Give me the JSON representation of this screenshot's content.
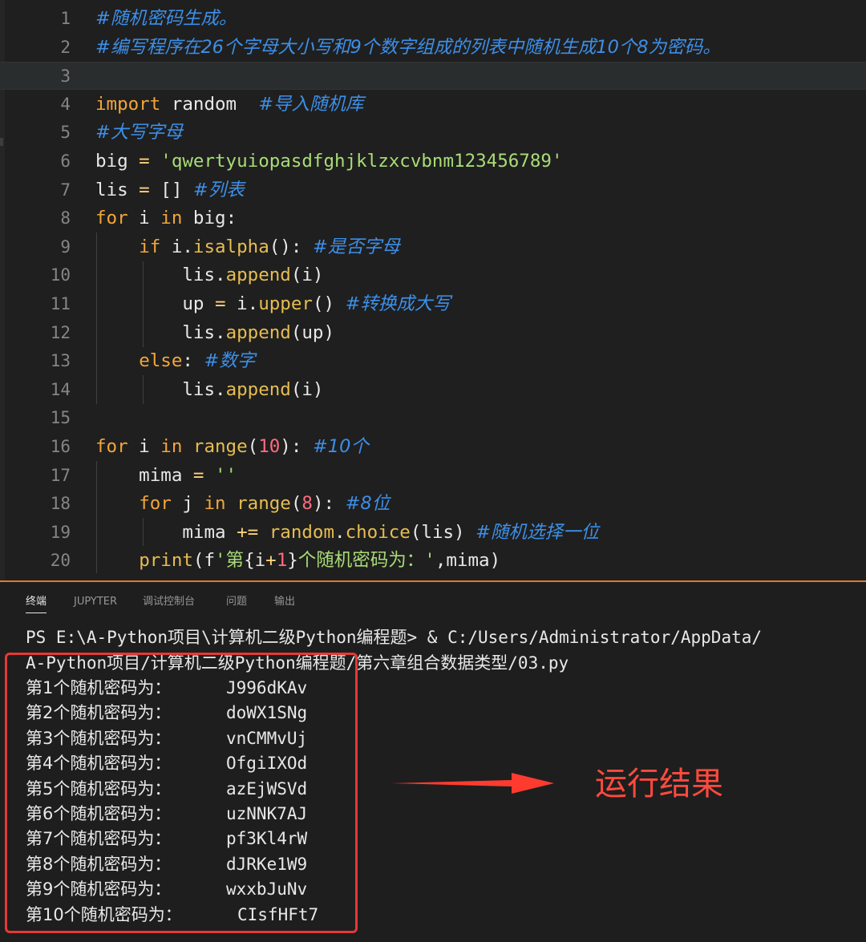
{
  "editor": {
    "lines": [
      {
        "n": "1",
        "tokens": [
          {
            "c": "cmt",
            "t": "#随机密码生成。"
          }
        ]
      },
      {
        "n": "2",
        "tokens": [
          {
            "c": "cmt",
            "t": "#编写程序在26个字母大小写和9个数字组成的列表中随机生成10个8为密码。"
          }
        ]
      },
      {
        "n": "3",
        "tokens": []
      },
      {
        "n": "4",
        "tokens": [
          {
            "c": "kw",
            "t": "import"
          },
          {
            "c": "var",
            "t": " random  "
          },
          {
            "c": "cmt",
            "t": "#导入随机库"
          }
        ]
      },
      {
        "n": "5",
        "tokens": [
          {
            "c": "cmt",
            "t": "#大写字母"
          }
        ]
      },
      {
        "n": "6",
        "tokens": [
          {
            "c": "var",
            "t": "big"
          },
          {
            "c": "op",
            "t": " = "
          },
          {
            "c": "str",
            "t": "'qwertyuiopasdfghjklzxcvbnm123456789'"
          }
        ]
      },
      {
        "n": "7",
        "tokens": [
          {
            "c": "var",
            "t": "lis"
          },
          {
            "c": "op",
            "t": " = "
          },
          {
            "c": "pun",
            "t": "[] "
          },
          {
            "c": "cmt",
            "t": "#列表"
          }
        ]
      },
      {
        "n": "8",
        "tokens": [
          {
            "c": "kw",
            "t": "for"
          },
          {
            "c": "var",
            "t": " i "
          },
          {
            "c": "kw",
            "t": "in"
          },
          {
            "c": "var",
            "t": " big"
          },
          {
            "c": "pun",
            "t": ":"
          }
        ]
      },
      {
        "n": "9",
        "tokens": [
          {
            "c": "var",
            "t": "    "
          },
          {
            "c": "kw",
            "t": "if"
          },
          {
            "c": "var",
            "t": " i."
          },
          {
            "c": "fn",
            "t": "isalpha"
          },
          {
            "c": "pun",
            "t": "(): "
          },
          {
            "c": "cmt",
            "t": "#是否字母"
          }
        ]
      },
      {
        "n": "10",
        "tokens": [
          {
            "c": "var",
            "t": "        lis."
          },
          {
            "c": "fn",
            "t": "append"
          },
          {
            "c": "pun",
            "t": "(i)"
          }
        ]
      },
      {
        "n": "11",
        "tokens": [
          {
            "c": "var",
            "t": "        up"
          },
          {
            "c": "op",
            "t": " = "
          },
          {
            "c": "var",
            "t": "i."
          },
          {
            "c": "fn",
            "t": "upper"
          },
          {
            "c": "pun",
            "t": "() "
          },
          {
            "c": "cmt",
            "t": "#转换成大写"
          }
        ]
      },
      {
        "n": "12",
        "tokens": [
          {
            "c": "var",
            "t": "        lis."
          },
          {
            "c": "fn",
            "t": "append"
          },
          {
            "c": "pun",
            "t": "(up)"
          }
        ]
      },
      {
        "n": "13",
        "tokens": [
          {
            "c": "var",
            "t": "    "
          },
          {
            "c": "kw",
            "t": "else"
          },
          {
            "c": "pun",
            "t": ": "
          },
          {
            "c": "cmt",
            "t": "#数字"
          }
        ]
      },
      {
        "n": "14",
        "tokens": [
          {
            "c": "var",
            "t": "        lis."
          },
          {
            "c": "fn",
            "t": "append"
          },
          {
            "c": "pun",
            "t": "(i)"
          }
        ]
      },
      {
        "n": "15",
        "tokens": []
      },
      {
        "n": "16",
        "tokens": [
          {
            "c": "kw",
            "t": "for"
          },
          {
            "c": "var",
            "t": " i "
          },
          {
            "c": "kw",
            "t": "in"
          },
          {
            "c": "fn",
            "t": " range"
          },
          {
            "c": "pun",
            "t": "("
          },
          {
            "c": "num",
            "t": "10"
          },
          {
            "c": "pun",
            "t": "): "
          },
          {
            "c": "cmt",
            "t": "#10个"
          }
        ]
      },
      {
        "n": "17",
        "tokens": [
          {
            "c": "var",
            "t": "    mima"
          },
          {
            "c": "op",
            "t": " = "
          },
          {
            "c": "str",
            "t": "''"
          }
        ]
      },
      {
        "n": "18",
        "tokens": [
          {
            "c": "var",
            "t": "    "
          },
          {
            "c": "kw",
            "t": "for"
          },
          {
            "c": "var",
            "t": " j "
          },
          {
            "c": "kw",
            "t": "in"
          },
          {
            "c": "fn",
            "t": " range"
          },
          {
            "c": "pun",
            "t": "("
          },
          {
            "c": "num",
            "t": "8"
          },
          {
            "c": "pun",
            "t": "): "
          },
          {
            "c": "cmt",
            "t": "#8位"
          }
        ]
      },
      {
        "n": "19",
        "tokens": [
          {
            "c": "var",
            "t": "        mima"
          },
          {
            "c": "op",
            "t": " += "
          },
          {
            "c": "fn",
            "t": "random"
          },
          {
            "c": "var",
            "t": "."
          },
          {
            "c": "fn",
            "t": "choice"
          },
          {
            "c": "pun",
            "t": "(lis) "
          },
          {
            "c": "cmt",
            "t": "#随机选择一位"
          }
        ]
      },
      {
        "n": "20",
        "tokens": [
          {
            "c": "var",
            "t": "    "
          },
          {
            "c": "fn",
            "t": "print"
          },
          {
            "c": "pun",
            "t": "(f"
          },
          {
            "c": "str",
            "t": "'第"
          },
          {
            "c": "pun",
            "t": "{"
          },
          {
            "c": "var",
            "t": "i"
          },
          {
            "c": "op",
            "t": "+"
          },
          {
            "c": "num",
            "t": "1"
          },
          {
            "c": "pun",
            "t": "}"
          },
          {
            "c": "str",
            "t": "个随机密码为：'"
          },
          {
            "c": "pun",
            "t": ",mima)"
          }
        ]
      }
    ]
  },
  "panel": {
    "tabs": [
      "终端",
      "JUPYTER",
      "调试控制台",
      "问题",
      "输出"
    ],
    "command_line_1": "PS E:\\A-Python项目\\计算机二级Python编程题> & C:/Users/Administrator/AppData/",
    "command_line_2": "A-Python项目/计算机二级Python编程题/第六章组合数据类型/03.py",
    "outputs": [
      {
        "label": "第1个随机密码为：",
        "pw": "J996dKAv"
      },
      {
        "label": "第2个随机密码为：",
        "pw": "doWX1SNg"
      },
      {
        "label": "第3个随机密码为：",
        "pw": "vnCMMvUj"
      },
      {
        "label": "第4个随机密码为：",
        "pw": "OfgiIXOd"
      },
      {
        "label": "第5个随机密码为：",
        "pw": "azEjWSVd"
      },
      {
        "label": "第6个随机密码为：",
        "pw": "uzNNK7AJ"
      },
      {
        "label": "第7个随机密码为：",
        "pw": "pf3Kl4rW"
      },
      {
        "label": "第8个随机密码为：",
        "pw": "dJRKe1W9"
      },
      {
        "label": "第9个随机密码为：",
        "pw": "wxxbJuNv"
      },
      {
        "label": "第10个随机密码为：",
        "pw": "CIsfHFt7"
      }
    ]
  },
  "annotation": {
    "text": "运行结果",
    "color": "#ff4a3d"
  }
}
